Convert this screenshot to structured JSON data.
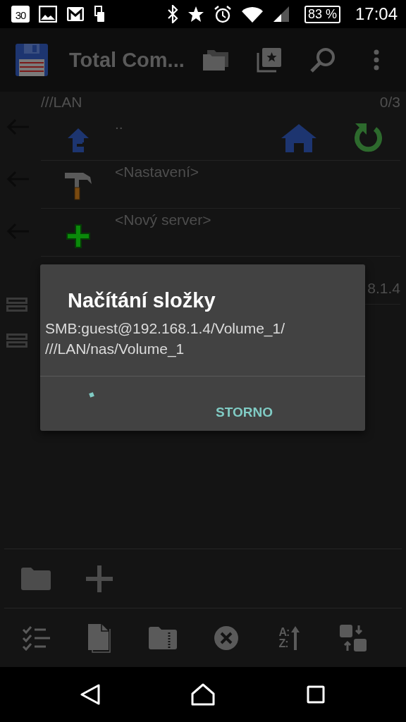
{
  "status_bar": {
    "calendar_day": "30",
    "battery": "83 %",
    "time": "17:04",
    "left_icons": [
      {
        "kind": "calendar"
      },
      {
        "kind": "image"
      },
      {
        "kind": "mail"
      },
      {
        "kind": "device"
      }
    ],
    "right_icons": [
      {
        "kind": "bluetooth"
      },
      {
        "kind": "star"
      },
      {
        "kind": "alarm"
      },
      {
        "kind": "wifi"
      },
      {
        "kind": "signal"
      }
    ]
  },
  "app_bar": {
    "title": "Total Com...",
    "actions": [
      {
        "kind": "folders"
      },
      {
        "kind": "favorites"
      },
      {
        "kind": "search"
      },
      {
        "kind": "more"
      }
    ]
  },
  "panel": {
    "path": "///LAN",
    "count": "0/3",
    "side_buttons": [
      {
        "kind": "back"
      },
      {
        "kind": "back"
      },
      {
        "kind": "back"
      },
      {
        "kind": "menu"
      },
      {
        "kind": "menu"
      }
    ],
    "rows": [
      {
        "kind": "up",
        "name": "..",
        "actions": [
          {
            "kind": "home"
          },
          {
            "kind": "refresh"
          }
        ]
      },
      {
        "kind": "settings",
        "name": "<Nastavení>"
      },
      {
        "kind": "add",
        "name": "<Nový server>"
      },
      {
        "kind": "server",
        "detail": "8.1.4"
      }
    ]
  },
  "dialog": {
    "title": "Načítání složky",
    "lines": [
      "SMB:guest@192.168.1.4/Volume_1/",
      "///LAN/nas/Volume_1"
    ],
    "button": "STORNO"
  },
  "toolbar": {
    "primary": [
      {
        "kind": "folder"
      },
      {
        "kind": "plus"
      }
    ],
    "secondary": [
      {
        "kind": "select"
      },
      {
        "kind": "copy"
      },
      {
        "kind": "zip"
      },
      {
        "kind": "delete"
      },
      {
        "kind": "sort",
        "letters": [
          "A:",
          "Z:"
        ]
      },
      {
        "kind": "swap"
      }
    ]
  },
  "nav_bar": [
    {
      "kind": "back"
    },
    {
      "kind": "home"
    },
    {
      "kind": "recents"
    }
  ]
}
